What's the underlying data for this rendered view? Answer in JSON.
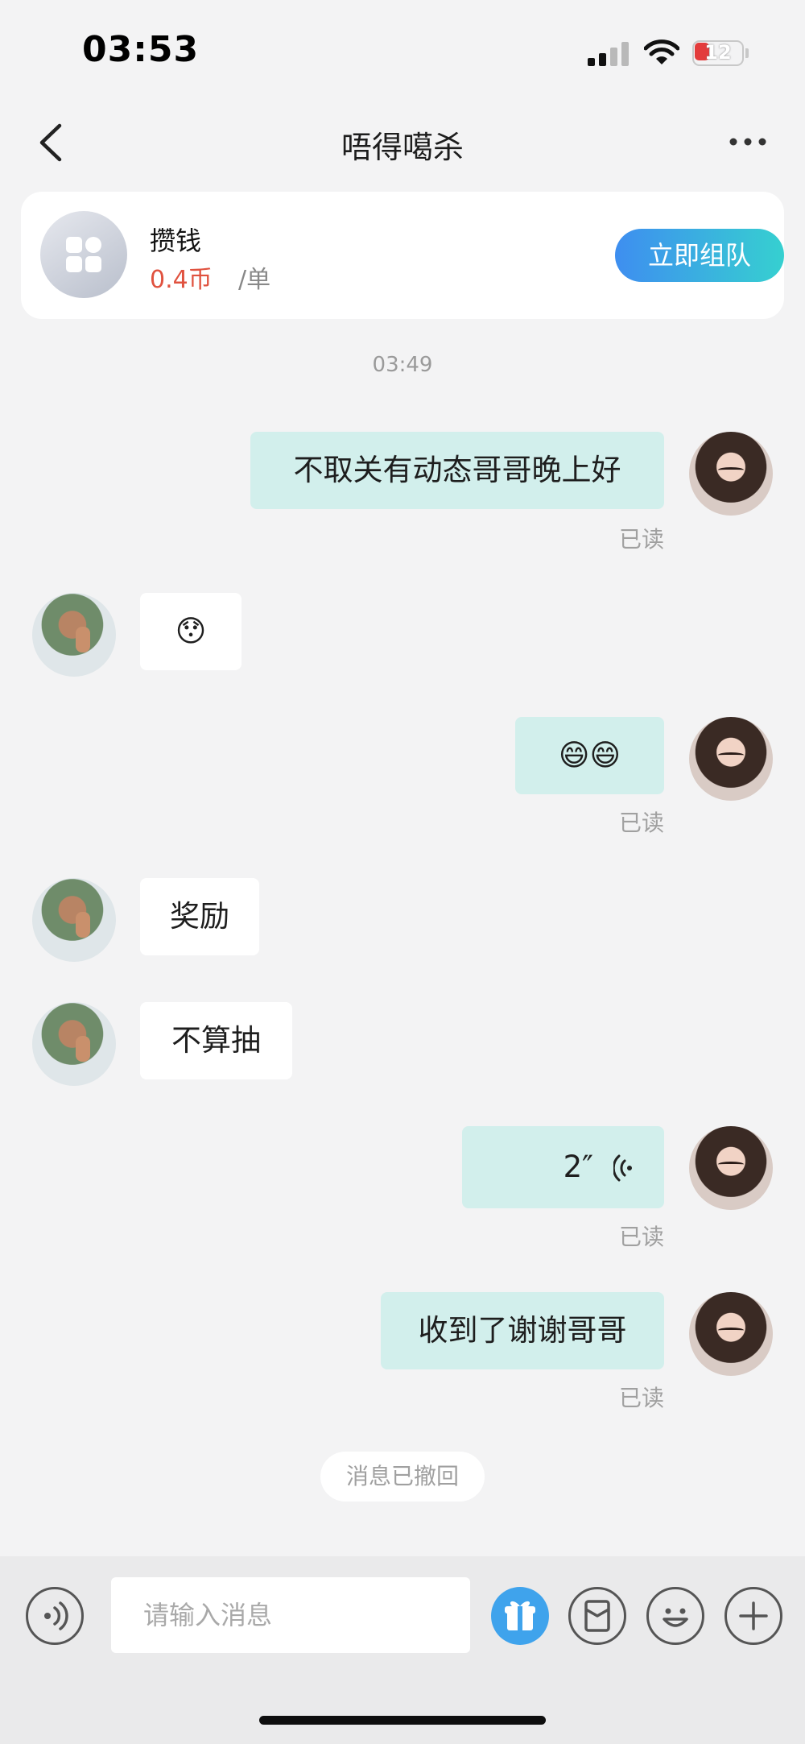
{
  "status_bar": {
    "time": "03:53",
    "battery": "12"
  },
  "nav": {
    "title": "唔得噶杀"
  },
  "task_card": {
    "name": "攒钱",
    "price": "0.4币",
    "unit": "/单",
    "button": "立即组队"
  },
  "chat": {
    "timestamp": "03:49",
    "messages": [
      {
        "side": "out",
        "text": "不取关有动态哥哥晚上好",
        "status": "已读"
      },
      {
        "side": "in",
        "text": "😯"
      },
      {
        "side": "out",
        "text": "😄😄",
        "status": "已读"
      },
      {
        "side": "in",
        "text": "奖励"
      },
      {
        "side": "in",
        "text": "不算抽"
      },
      {
        "side": "out",
        "text": "2″",
        "kind": "voice",
        "status": "已读"
      },
      {
        "side": "out",
        "text": "收到了谢谢哥哥",
        "status": "已读"
      }
    ],
    "recall_notice": "消息已撤回"
  },
  "input_bar": {
    "placeholder": "请输入消息"
  },
  "icons": {
    "voice": "voice-toggle-icon",
    "gift": "gift-icon",
    "red_packet": "red-packet-icon",
    "emoji": "emoji-icon",
    "plus": "plus-icon"
  },
  "colors": {
    "outgoing_bubble": "#d2efec",
    "incoming_bubble": "#ffffff",
    "price": "#e0523f",
    "button_gradient_start": "#3e8ef0",
    "button_gradient_end": "#36d0d0"
  }
}
